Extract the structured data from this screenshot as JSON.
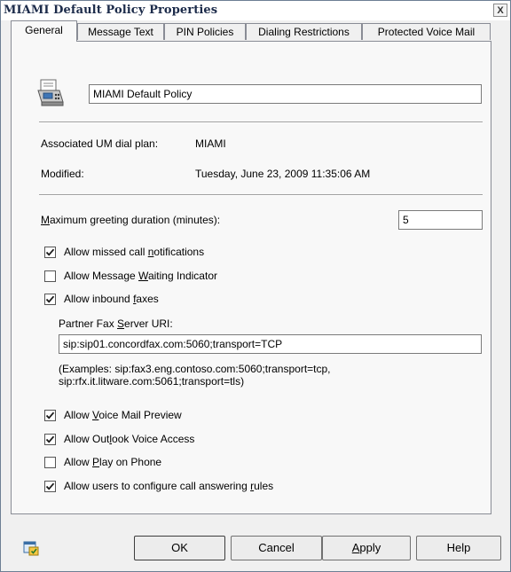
{
  "window": {
    "title": "MIAMI Default Policy Properties",
    "close_glyph": "X"
  },
  "tabs": [
    {
      "label": "General",
      "active": true
    },
    {
      "label": "Message Text",
      "active": false
    },
    {
      "label": "PIN Policies",
      "active": false
    },
    {
      "label": "Dialing Restrictions",
      "active": false
    },
    {
      "label": "Protected Voice Mail",
      "active": false
    }
  ],
  "general": {
    "policy_icon": "fax-icon",
    "policy_name": "MIAMI Default Policy",
    "dial_plan_label": "Associated UM dial plan:",
    "dial_plan_value": "MIAMI",
    "modified_label": "Modified:",
    "modified_value": "Tuesday, June 23, 2009 11:35:06 AM",
    "max_greeting": {
      "pre": "",
      "acc": "M",
      "post": "aximum greeting duration (minutes):",
      "value": "5"
    },
    "checks1": [
      {
        "pre": "Allow missed call ",
        "acc": "n",
        "post": "otifications",
        "checked": true
      },
      {
        "pre": "Allow Message ",
        "acc": "W",
        "post": "aiting Indicator",
        "checked": false
      },
      {
        "pre": "Allow inbound ",
        "acc": "f",
        "post": "axes",
        "checked": true
      }
    ],
    "fax_uri": {
      "pre": "Partner Fax ",
      "acc": "S",
      "post": "erver URI:",
      "value": "sip:sip01.concordfax.com:5060;transport=TCP"
    },
    "examples_line1": "(Examples: sip:fax3.eng.contoso.com:5060;transport=tcp,",
    "examples_line2": "sip:rfx.it.litware.com:5061;transport=tls)",
    "checks2": [
      {
        "pre": "Allow ",
        "acc": "V",
        "post": "oice Mail Preview",
        "checked": true
      },
      {
        "pre": "Allow Out",
        "acc": "l",
        "post": "ook Voice Access",
        "checked": true
      },
      {
        "pre": "Allow ",
        "acc": "P",
        "post": "lay on Phone",
        "checked": false
      },
      {
        "pre": "Allow users to configure call answering ",
        "acc": "r",
        "post": "ules",
        "checked": true
      }
    ]
  },
  "footer": {
    "help_icon": "help-context-icon",
    "ok": "OK",
    "cancel": "Cancel",
    "apply": {
      "pre": "",
      "acc": "A",
      "post": "pply"
    },
    "help": "Help"
  },
  "colors": {
    "panel": "#f8f8f8",
    "dialog": "#f0f0f0",
    "title_text": "#1c2b4a",
    "border": "#898c95"
  }
}
